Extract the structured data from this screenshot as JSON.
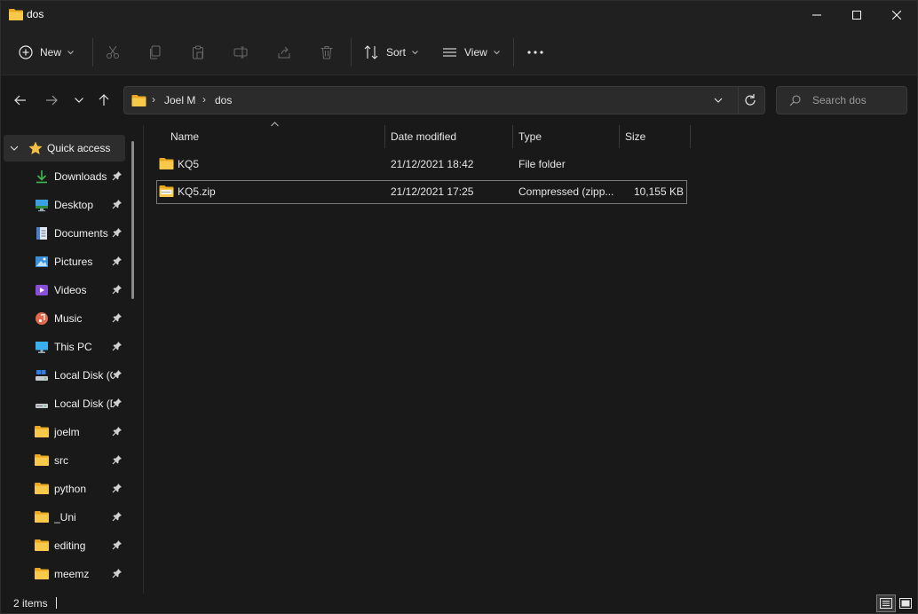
{
  "window": {
    "title": "dos"
  },
  "toolbar": {
    "new_label": "New",
    "sort_label": "Sort",
    "view_label": "View"
  },
  "address": {
    "crumbs": [
      "Joel M",
      "dos"
    ]
  },
  "search": {
    "placeholder": "Search dos"
  },
  "sidebar": {
    "quick_access_label": "Quick access",
    "items": [
      {
        "label": "Downloads",
        "icon": "downloads-icon"
      },
      {
        "label": "Desktop",
        "icon": "desktop-icon"
      },
      {
        "label": "Documents",
        "icon": "documents-icon"
      },
      {
        "label": "Pictures",
        "icon": "pictures-icon"
      },
      {
        "label": "Videos",
        "icon": "videos-icon"
      },
      {
        "label": "Music",
        "icon": "music-icon"
      },
      {
        "label": "This PC",
        "icon": "this-pc-icon"
      },
      {
        "label": "Local Disk (C:)",
        "icon": "local-disk-c-icon"
      },
      {
        "label": "Local Disk (D:)",
        "icon": "local-disk-d-icon"
      },
      {
        "label": "joelm",
        "icon": "folder-icon"
      },
      {
        "label": "src",
        "icon": "folder-icon"
      },
      {
        "label": "python",
        "icon": "folder-icon"
      },
      {
        "label": "_Uni",
        "icon": "folder-icon"
      },
      {
        "label": "editing",
        "icon": "folder-icon"
      },
      {
        "label": "meemz",
        "icon": "folder-icon"
      }
    ]
  },
  "columns": {
    "name": "Name",
    "date": "Date modified",
    "type": "Type",
    "size": "Size"
  },
  "files": [
    {
      "name": "KQ5",
      "date": "21/12/2021 18:42",
      "type": "File folder",
      "size": "",
      "icon": "folder-icon"
    },
    {
      "name": "KQ5.zip",
      "date": "21/12/2021 17:25",
      "type": "Compressed (zipp...",
      "size": "10,155 KB",
      "icon": "zip-folder-icon"
    }
  ],
  "status": {
    "item_count": "2 items"
  },
  "colors": {
    "folder": "#f5c142",
    "background": "#191919",
    "accent": "#4cc2ff"
  }
}
